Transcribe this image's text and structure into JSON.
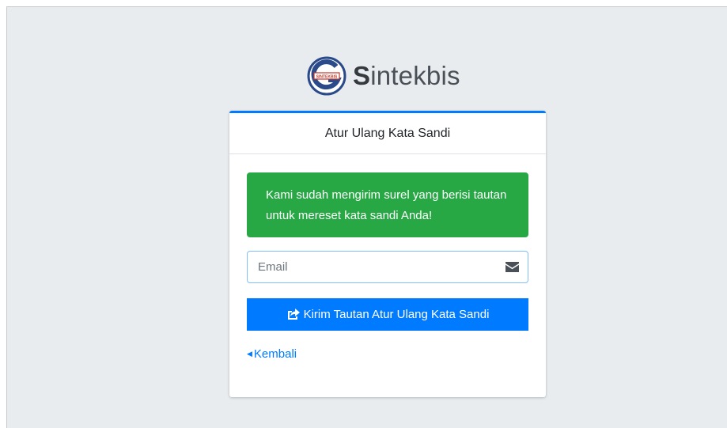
{
  "brand": {
    "logo_icon": "sintekbis-logo-icon",
    "name_initial": "S",
    "name_rest": "intekbis",
    "logo_badge_text": "SINTEKBIS"
  },
  "card": {
    "title": "Atur Ulang Kata Sandi",
    "accent_color": "#007bff"
  },
  "alert": {
    "message": "Kami sudah mengirim surel yang berisi tautan untuk mereset kata sandi Anda!",
    "color": "#28a745"
  },
  "email_field": {
    "placeholder": "Email",
    "value": "",
    "icon": "envelope-icon"
  },
  "submit_button": {
    "label": "Kirim Tautan Atur Ulang Kata Sandi",
    "icon": "share-icon",
    "color": "#007bff"
  },
  "back_link": {
    "label": "Kembali",
    "icon": "caret-left-icon"
  }
}
